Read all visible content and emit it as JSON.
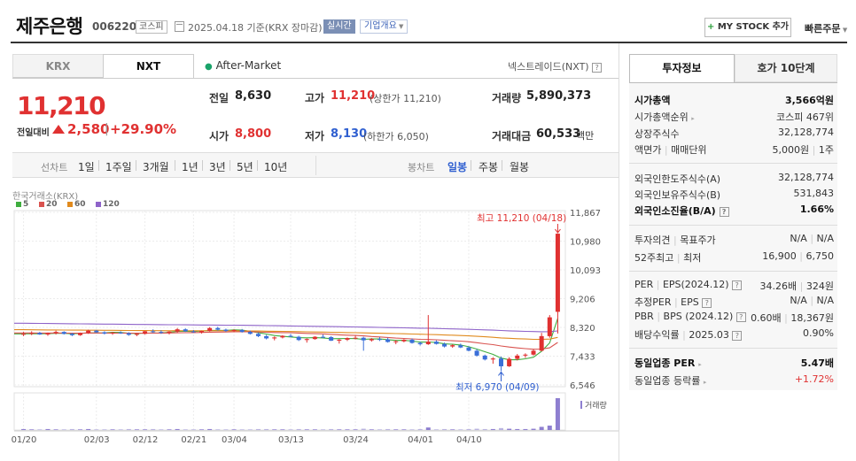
{
  "header": {
    "name": "제주은행",
    "code": "006220",
    "market": "코스피",
    "date_text": "2025.04.18  기준(KRX 장마감)",
    "realtime": "실시간",
    "overview": "기업개요",
    "mystock_plus": "+",
    "mystock": "MY STOCK 추가",
    "quick_order": "빠른주문"
  },
  "tabs": {
    "krx": "KRX",
    "nxt": "NXT"
  },
  "after_market": "After-Market",
  "nextrade": "넥스트레이드(NXT)",
  "price": {
    "current": "11,210",
    "change_label": "전일대비",
    "change": "2,580",
    "change_pct": "+29.90%",
    "up_color": "#e03131"
  },
  "stats": {
    "prev_close_label": "전일",
    "prev_close": "8,630",
    "high_label": "고가",
    "high": "11,210",
    "high_sub": "(상한가 11,210)",
    "volume_label": "거래량",
    "volume": "5,890,373",
    "open_label": "시가",
    "open": "8,800",
    "low_label": "저가",
    "low": "8,130",
    "low_sub": "(하한가 6,050)",
    "amount_label": "거래대금",
    "amount": "60,533",
    "amount_unit": "백만"
  },
  "periods": {
    "line_label": "선차트",
    "line_items": [
      "1일",
      "1주일",
      "3개월",
      "1년",
      "3년",
      "5년",
      "10년"
    ],
    "candle_label": "봉차트",
    "candle_items": [
      "일봉",
      "주봉",
      "월봉"
    ],
    "candle_active": "일봉"
  },
  "chart": {
    "source": "한국거래소(KRX)",
    "legend": [
      {
        "label": "5",
        "color": "#3fae3f"
      },
      {
        "label": "20",
        "color": "#d9534f"
      },
      {
        "label": "60",
        "color": "#e08a1e"
      },
      {
        "label": "120",
        "color": "#8e63c9"
      }
    ],
    "high_annot": "최고 11,210 (04/18)",
    "low_annot": "최저 6,970 (04/09)",
    "volume_label": "거래량",
    "up_color": "#e03131",
    "down_color": "#3a6fd8"
  },
  "chart_data": {
    "type": "candlestick",
    "y_ticks": [
      11867,
      10980,
      10093,
      9206,
      8320,
      7433,
      6546
    ],
    "ylim": [
      6546,
      11867
    ],
    "x_ticks": [
      "01/20",
      "02/03",
      "02/12",
      "02/21",
      "03/04",
      "03/13",
      "03/24",
      "04/01",
      "04/10"
    ],
    "candles": [
      [
        8100,
        8180,
        8050,
        8120
      ],
      [
        8120,
        8200,
        8080,
        8150
      ],
      [
        8150,
        8180,
        8090,
        8100
      ],
      [
        8100,
        8160,
        8060,
        8140
      ],
      [
        8140,
        8220,
        8100,
        8180
      ],
      [
        8180,
        8200,
        8100,
        8120
      ],
      [
        8120,
        8150,
        8050,
        8080
      ],
      [
        8080,
        8160,
        8060,
        8150
      ],
      [
        8150,
        8250,
        8120,
        8220
      ],
      [
        8220,
        8240,
        8150,
        8170
      ],
      [
        8170,
        8200,
        8100,
        8130
      ],
      [
        8130,
        8180,
        8090,
        8160
      ],
      [
        8160,
        8200,
        8120,
        8140
      ],
      [
        8140,
        8170,
        8060,
        8090
      ],
      [
        8090,
        8140,
        8050,
        8120
      ],
      [
        8120,
        8210,
        8100,
        8200
      ],
      [
        8200,
        8260,
        8150,
        8180
      ],
      [
        8180,
        8230,
        8120,
        8150
      ],
      [
        8150,
        8200,
        8100,
        8190
      ],
      [
        8190,
        8300,
        8150,
        8260
      ],
      [
        8260,
        8290,
        8180,
        8200
      ],
      [
        8200,
        8240,
        8150,
        8170
      ],
      [
        8170,
        8220,
        8130,
        8210
      ],
      [
        8210,
        8330,
        8190,
        8300
      ],
      [
        8300,
        8340,
        8220,
        8250
      ],
      [
        8250,
        8280,
        8180,
        8210
      ],
      [
        8210,
        8260,
        8170,
        8240
      ],
      [
        8240,
        8270,
        8160,
        8180
      ],
      [
        8180,
        8220,
        8100,
        8120
      ],
      [
        8120,
        8160,
        8020,
        8050
      ],
      [
        8050,
        8090,
        7950,
        7980
      ],
      [
        7980,
        8040,
        7920,
        8010
      ],
      [
        8010,
        8080,
        7980,
        8060
      ],
      [
        8060,
        8120,
        8020,
        8030
      ],
      [
        8030,
        8060,
        7900,
        7930
      ],
      [
        7930,
        7980,
        7850,
        7960
      ],
      [
        7960,
        8050,
        7940,
        8030
      ],
      [
        8030,
        8100,
        7990,
        8020
      ],
      [
        8020,
        8050,
        7900,
        7910
      ],
      [
        7910,
        7960,
        7820,
        7940
      ],
      [
        7940,
        8010,
        7900,
        7990
      ],
      [
        7990,
        8060,
        7950,
        8000
      ],
      [
        8000,
        8030,
        7600,
        7920
      ],
      [
        7920,
        7990,
        7880,
        7960
      ],
      [
        7960,
        8020,
        7900,
        7950
      ],
      [
        7950,
        8000,
        7850,
        7870
      ],
      [
        7870,
        7930,
        7800,
        7890
      ],
      [
        7890,
        7960,
        7860,
        7940
      ],
      [
        7940,
        7980,
        7820,
        7840
      ],
      [
        7840,
        7880,
        7760,
        7800
      ],
      [
        7800,
        8700,
        7780,
        7880
      ],
      [
        7880,
        7920,
        7790,
        7810
      ],
      [
        7810,
        7850,
        7700,
        7730
      ],
      [
        7730,
        7800,
        7690,
        7770
      ],
      [
        7770,
        7820,
        7680,
        7700
      ],
      [
        7700,
        7740,
        7580,
        7600
      ],
      [
        7600,
        7650,
        7420,
        7450
      ],
      [
        7450,
        7480,
        7300,
        7330
      ],
      [
        7330,
        7400,
        7200,
        7360
      ],
      [
        7360,
        7420,
        6970,
        7120
      ],
      [
        7120,
        7400,
        7100,
        7350
      ],
      [
        7350,
        7500,
        7300,
        7450
      ],
      [
        7450,
        7520,
        7380,
        7480
      ],
      [
        7480,
        7650,
        7450,
        7600
      ],
      [
        7600,
        8150,
        7580,
        8050
      ],
      [
        8050,
        8700,
        8000,
        8630
      ],
      [
        8800,
        11210,
        8130,
        11210
      ]
    ],
    "volumes_rel": [
      3,
      2,
      2,
      3,
      2,
      2,
      3,
      2,
      3,
      2,
      2,
      2,
      2,
      3,
      2,
      2,
      3,
      2,
      2,
      3,
      2,
      2,
      2,
      3,
      2,
      2,
      2,
      2,
      2,
      3,
      3,
      2,
      2,
      2,
      3,
      2,
      2,
      2,
      3,
      2,
      2,
      2,
      4,
      2,
      2,
      3,
      2,
      2,
      2,
      3,
      8,
      2,
      3,
      2,
      2,
      3,
      4,
      3,
      3,
      6,
      4,
      3,
      3,
      4,
      10,
      14,
      100
    ]
  }
}
